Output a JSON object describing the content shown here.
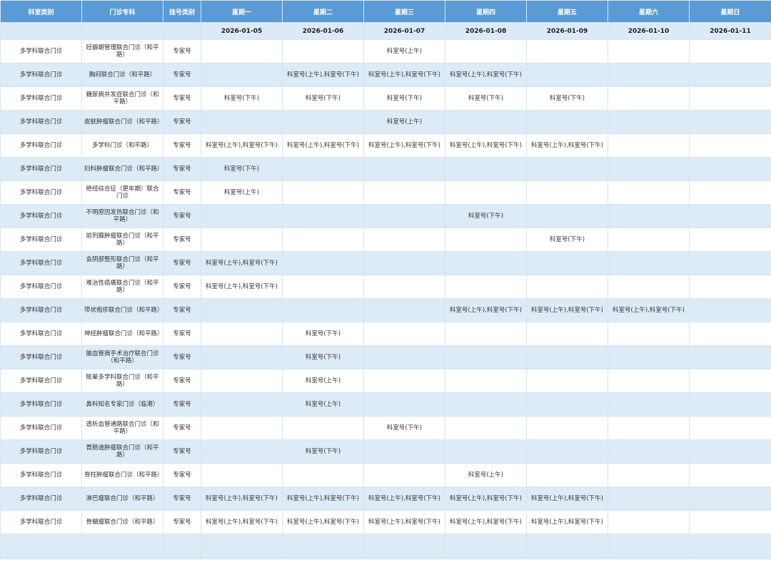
{
  "header": {
    "columns": [
      "科室类别",
      "门诊专科",
      "挂号类别",
      "星期一",
      "星期二",
      "星期三",
      "星期四",
      "星期五",
      "星期六",
      "星期日"
    ],
    "dates": [
      "",
      "",
      "",
      "2026-01-05",
      "2026-01-06",
      "2026-01-07",
      "2026-01-08",
      "2026-01-09",
      "2026-01-10",
      "2026-01-11"
    ]
  },
  "rows": [
    [
      "多学科联合门诊",
      "妊娠期管理联合门诊（和平路）",
      "专家号",
      "",
      "",
      "科室号(上午)",
      "",
      "",
      "",
      ""
    ],
    [
      "多学科联合门诊",
      "胸闷联合门诊（和平路）",
      "专家号",
      "",
      "科室号(上午),科室号(下午)",
      "科室号(上午),科室号(下午)",
      "科室号(上午),科室号(下午)",
      "",
      "",
      ""
    ],
    [
      "多学科联合门诊",
      "糖尿病并发症联合门诊（和平路）",
      "专家号",
      "科室号(下午)",
      "科室号(下午)",
      "科室号(下午)",
      "科室号(下午)",
      "科室号(下午)",
      "",
      ""
    ],
    [
      "多学科联合门诊",
      "皮肤肿瘤联合门诊（和平路）",
      "专家号",
      "",
      "",
      "科室号(上午)",
      "",
      "",
      "",
      ""
    ],
    [
      "多学科联合门诊",
      "多学科门诊（和平路）",
      "专家号",
      "科室号(上午),科室号(下午)",
      "科室号(上午),科室号(下午)",
      "科室号(上午),科室号(下午)",
      "科室号(上午),科室号(下午)",
      "科室号(上午),科室号(下午)",
      "",
      ""
    ],
    [
      "多学科联合门诊",
      "妇科肿瘤联合门诊（和平路）",
      "专家号",
      "科室号(下午)",
      "",
      "",
      "",
      "",
      "",
      ""
    ],
    [
      "多学科联合门诊",
      "绝经综合征（更年期）联合门诊",
      "专家号",
      "科室号(上午)",
      "",
      "",
      "",
      "",
      "",
      ""
    ],
    [
      "多学科联合门诊",
      "不明原因发热联合门诊（和平路）",
      "专家号",
      "",
      "",
      "",
      "科室号(下午)",
      "",
      "",
      ""
    ],
    [
      "多学科联合门诊",
      "前列腺肿瘤联合门诊（和平路）",
      "专家号",
      "",
      "",
      "",
      "",
      "科室号(下午)",
      "",
      ""
    ],
    [
      "多学科联合门诊",
      "会阴部整形联合门诊（和平路）",
      "专家号",
      "科室号(上午),科室号(下午)",
      "",
      "",
      "",
      "",
      "",
      ""
    ],
    [
      "多学科联合门诊",
      "难治性癌痛联合门诊（和平路）",
      "专家号",
      "科室号(上午),科室号(下午)",
      "",
      "",
      "",
      "",
      "",
      ""
    ],
    [
      "多学科联合门诊",
      "带状疱疹联合门诊（和平路）",
      "专家号",
      "",
      "",
      "",
      "科室号(上午),科室号(下午)",
      "科室号(上午),科室号(下午)",
      "科室号(上午),科室号(下午)",
      ""
    ],
    [
      "多学科联合门诊",
      "神经肿瘤联合门诊（和平路）",
      "专家号",
      "",
      "科室号(下午)",
      "",
      "",
      "",
      "",
      ""
    ],
    [
      "多学科联合门诊",
      "脑血管病手术治疗联合门诊（和平路）",
      "专家号",
      "",
      "科室号(下午)",
      "",
      "",
      "",
      "",
      ""
    ],
    [
      "多学科联合门诊",
      "眩晕多学科联合门诊（和平路）",
      "专家号",
      "",
      "科室号(上午)",
      "",
      "",
      "",
      "",
      ""
    ],
    [
      "多学科联合门诊",
      "鼻科知名专家门诊（临港）",
      "专家号",
      "",
      "科室号(上午)",
      "",
      "",
      "",
      "",
      ""
    ],
    [
      "多学科联合门诊",
      "透析血管通路联合门诊（和平路）",
      "专家号",
      "",
      "",
      "科室号(下午)",
      "",
      "",
      "",
      ""
    ],
    [
      "多学科联合门诊",
      "胃肠道肿瘤联合门诊（和平路）",
      "专家号",
      "",
      "科室号(下午)",
      "",
      "",
      "",
      "",
      ""
    ],
    [
      "多学科联合门诊",
      "脊柱肿瘤联合门诊（和平路）",
      "专家号",
      "",
      "",
      "",
      "科室号(上午)",
      "",
      "",
      ""
    ],
    [
      "多学科联合门诊",
      "淋巴瘤联合门诊（和平路）",
      "专家号",
      "科室号(上午),科室号(下午)",
      "科室号(上午),科室号(下午)",
      "科室号(上午),科室号(下午)",
      "科室号(上午),科室号(下午)",
      "科室号(上午),科室号(下午)",
      "",
      ""
    ],
    [
      "多学科联合门诊",
      "骨髓瘤联合门诊（和平路）",
      "专家号",
      "科室号(上午),科室号(下午)",
      "科室号(上午),科室号(下午)",
      "科室号(上午),科室号(下午)",
      "科室号(上午),科室号(下午)",
      "科室号(上午),科室号(下午)",
      "",
      ""
    ]
  ],
  "colors": {
    "header_bg": "#5b9bd5",
    "date_row_bg": "#dceaf7",
    "stripe_bg": "#ddebf7",
    "grid_line": "#d6e4f2",
    "date_row_border": "#4caf50"
  }
}
